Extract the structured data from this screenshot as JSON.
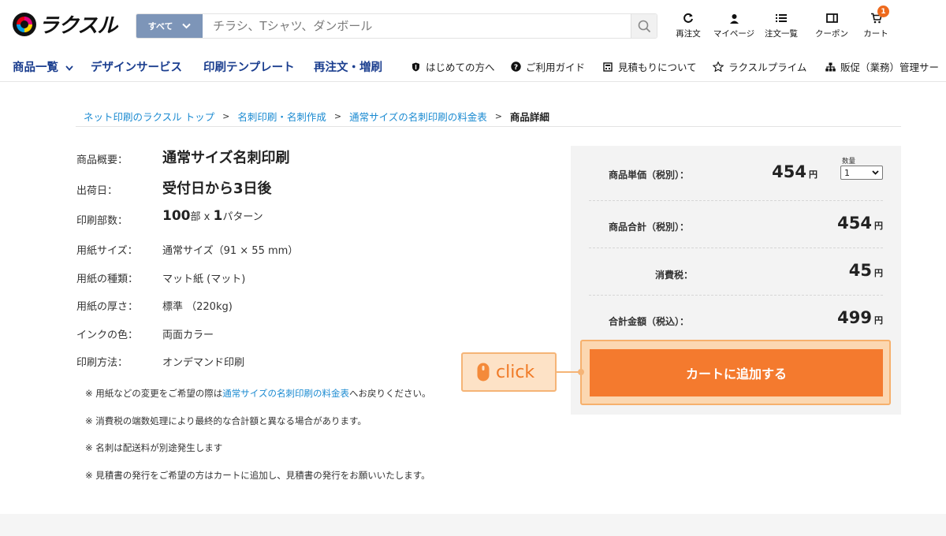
{
  "header": {
    "logo_text": "ラクスル",
    "search": {
      "category": "すべて",
      "placeholder": "チラシ、Tシャツ、ダンボール"
    },
    "nav": {
      "reorder": "再注文",
      "mypage": "マイページ",
      "orders": "注文一覧",
      "coupons": "クーポン",
      "cart": "カート",
      "cart_count": "1"
    }
  },
  "subnav": {
    "products": "商品一覧",
    "design": "デザインサービス",
    "templates": "印刷テンプレート",
    "reorder": "再注文・増刷",
    "beginners": "はじめての方へ",
    "guide": "ご利用ガイド",
    "estimate": "見積もりについて",
    "prime": "ラクスルプライム",
    "promo": "販促（業務）管理サー"
  },
  "breadcrumb": {
    "top": "ネット印刷のラクスル トップ",
    "category": "名刺印刷・名刺作成",
    "pricing": "通常サイズの名刺印刷の料金表",
    "current": "商品詳細",
    "separator": ">"
  },
  "spec": {
    "summary_label": "商品概要：",
    "summary_value": "通常サイズ名刺印刷",
    "ship_label": "出荷日：",
    "ship_value": "受付日から3日後",
    "copies_label": "印刷部数：",
    "copies_num": "100",
    "copies_unit": "部 x ",
    "patterns_num": "1",
    "patterns_unit": "パターン",
    "paper_size_label": "用紙サイズ：",
    "paper_size_value": "通常サイズ（91 × 55 mm）",
    "paper_type_label": "用紙の種類：",
    "paper_type_value": "マット紙 (マット)",
    "paper_weight_label": "用紙の厚さ：",
    "paper_weight_value": "標準 （220kg)",
    "ink_label": "インクの色：",
    "ink_value": "両面カラー",
    "method_label": "印刷方法：",
    "method_value": "オンデマンド印刷"
  },
  "notes": {
    "note1_prefix": "※ 用紙などの変更をご希望の際は",
    "note1_link": "通常サイズの名刺印刷の料金表",
    "note1_suffix": "へお戻りください。",
    "note2": "※ 消費税の端数処理により最終的な合計額と異なる場合があります。",
    "note3": "※ 名刺は配送料が別途発生します",
    "note4": "※ 見積書の発行をご希望の方はカートに追加し、見積書の発行をお願いいたします。"
  },
  "price": {
    "unit_label": "商品単価（税別）：",
    "unit_value": "454",
    "subtotal_label": "商品合計（税別）：",
    "subtotal_value": "454",
    "tax_label": "消費税：",
    "tax_value": "45",
    "total_label": "合計金額（税込）：",
    "total_value": "499",
    "yen": "円",
    "qty_caption": "数量",
    "qty_selected": "1",
    "add_to_cart": "カートに追加する"
  },
  "annotation": {
    "click_text": "click"
  },
  "colors": {
    "accent_orange": "#f47a2e",
    "nav_blue": "#1b3e8f",
    "link_blue": "#1a8ad1",
    "badge": "#ee6a1d"
  }
}
